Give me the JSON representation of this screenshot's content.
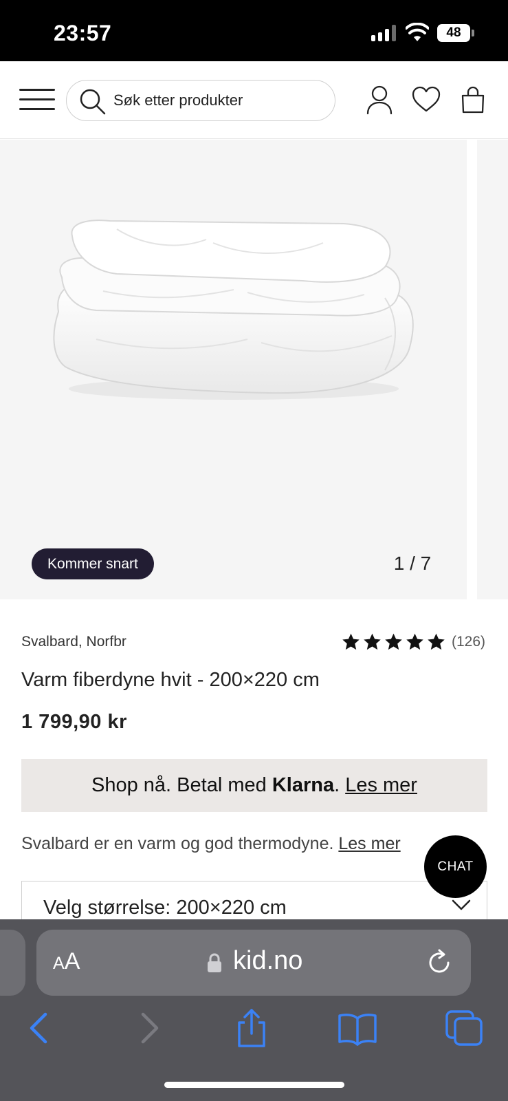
{
  "status_bar": {
    "time": "23:57",
    "battery": "48"
  },
  "header": {
    "search_placeholder": "Søk etter produkter",
    "icons": [
      "menu-icon",
      "search-icon",
      "account-icon",
      "heart-icon",
      "bag-icon"
    ]
  },
  "gallery": {
    "badge": "Kommer snart",
    "counter": "1 / 7"
  },
  "product": {
    "brand": "Svalbard, Norfbr",
    "rating_stars": 5,
    "review_count": "(126)",
    "title": "Varm fiberdyne hvit - 200×220 cm",
    "price": "1 799,90 kr"
  },
  "klarna": {
    "text_before": "Shop nå. Betal med ",
    "brand": "Klarna",
    "dot": ". ",
    "link": "Les mer"
  },
  "description": {
    "text": "Svalbard er en varm og god thermodyne. ",
    "link": "Les mer"
  },
  "size_select": {
    "label": "Velg størrelse: 200×220 cm"
  },
  "chat": {
    "label": "CHAT"
  },
  "safari": {
    "aa_small": "A",
    "aa_large": "A",
    "url": "kid.no"
  },
  "colors": {
    "badge_bg": "#221d33",
    "klarna_bg": "#ebe8e6",
    "gallery_bg": "#f5f5f5",
    "safari_bar": "#545459",
    "safari_accent": "#3b82f6"
  }
}
